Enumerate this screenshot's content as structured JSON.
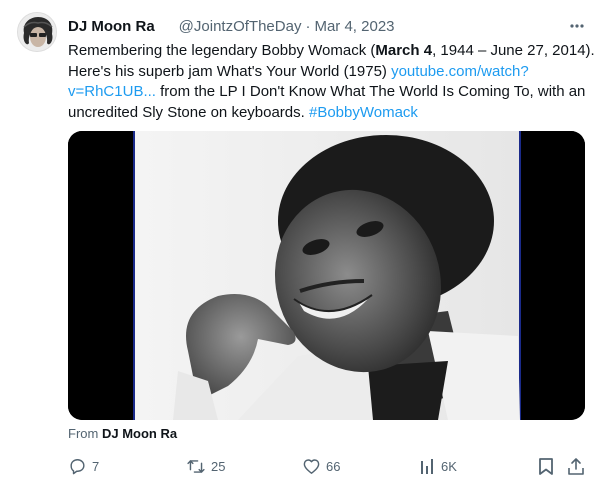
{
  "tweet": {
    "display_name": "DJ Moon Ra",
    "handle": "@JointzOfTheDay",
    "separator": "·",
    "date": "Mar 4, 2023",
    "more_label": "···",
    "text": {
      "p1": "Remembering the legendary Bobby Womack (",
      "bold": "March 4",
      "p2": ", 1944 – June 27, 2014). Here's his superb jam What's Your World (1975) ",
      "link": "youtube.com/watch?v=RhC1UB...",
      "p3": " from the LP I Don't Know What The World Is Coming To, with an uncredited Sly Stone on keyboards. ",
      "hashtag": "#BobbyWomack"
    },
    "media_from_prefix": "From",
    "media_from_name": "DJ Moon Ra"
  },
  "actions": {
    "reply_count": "7",
    "retweet_count": "25",
    "like_count": "66",
    "views_count": "6K"
  },
  "icons": {
    "reply": "reply-icon",
    "retweet": "retweet-icon",
    "like": "heart-icon",
    "views": "views-icon",
    "bookmark": "bookmark-icon",
    "share": "share-icon",
    "more": "more-icon"
  },
  "colors": {
    "link": "#1d9bf0",
    "secondary_text": "#536471",
    "primary_text": "#0f1419"
  }
}
